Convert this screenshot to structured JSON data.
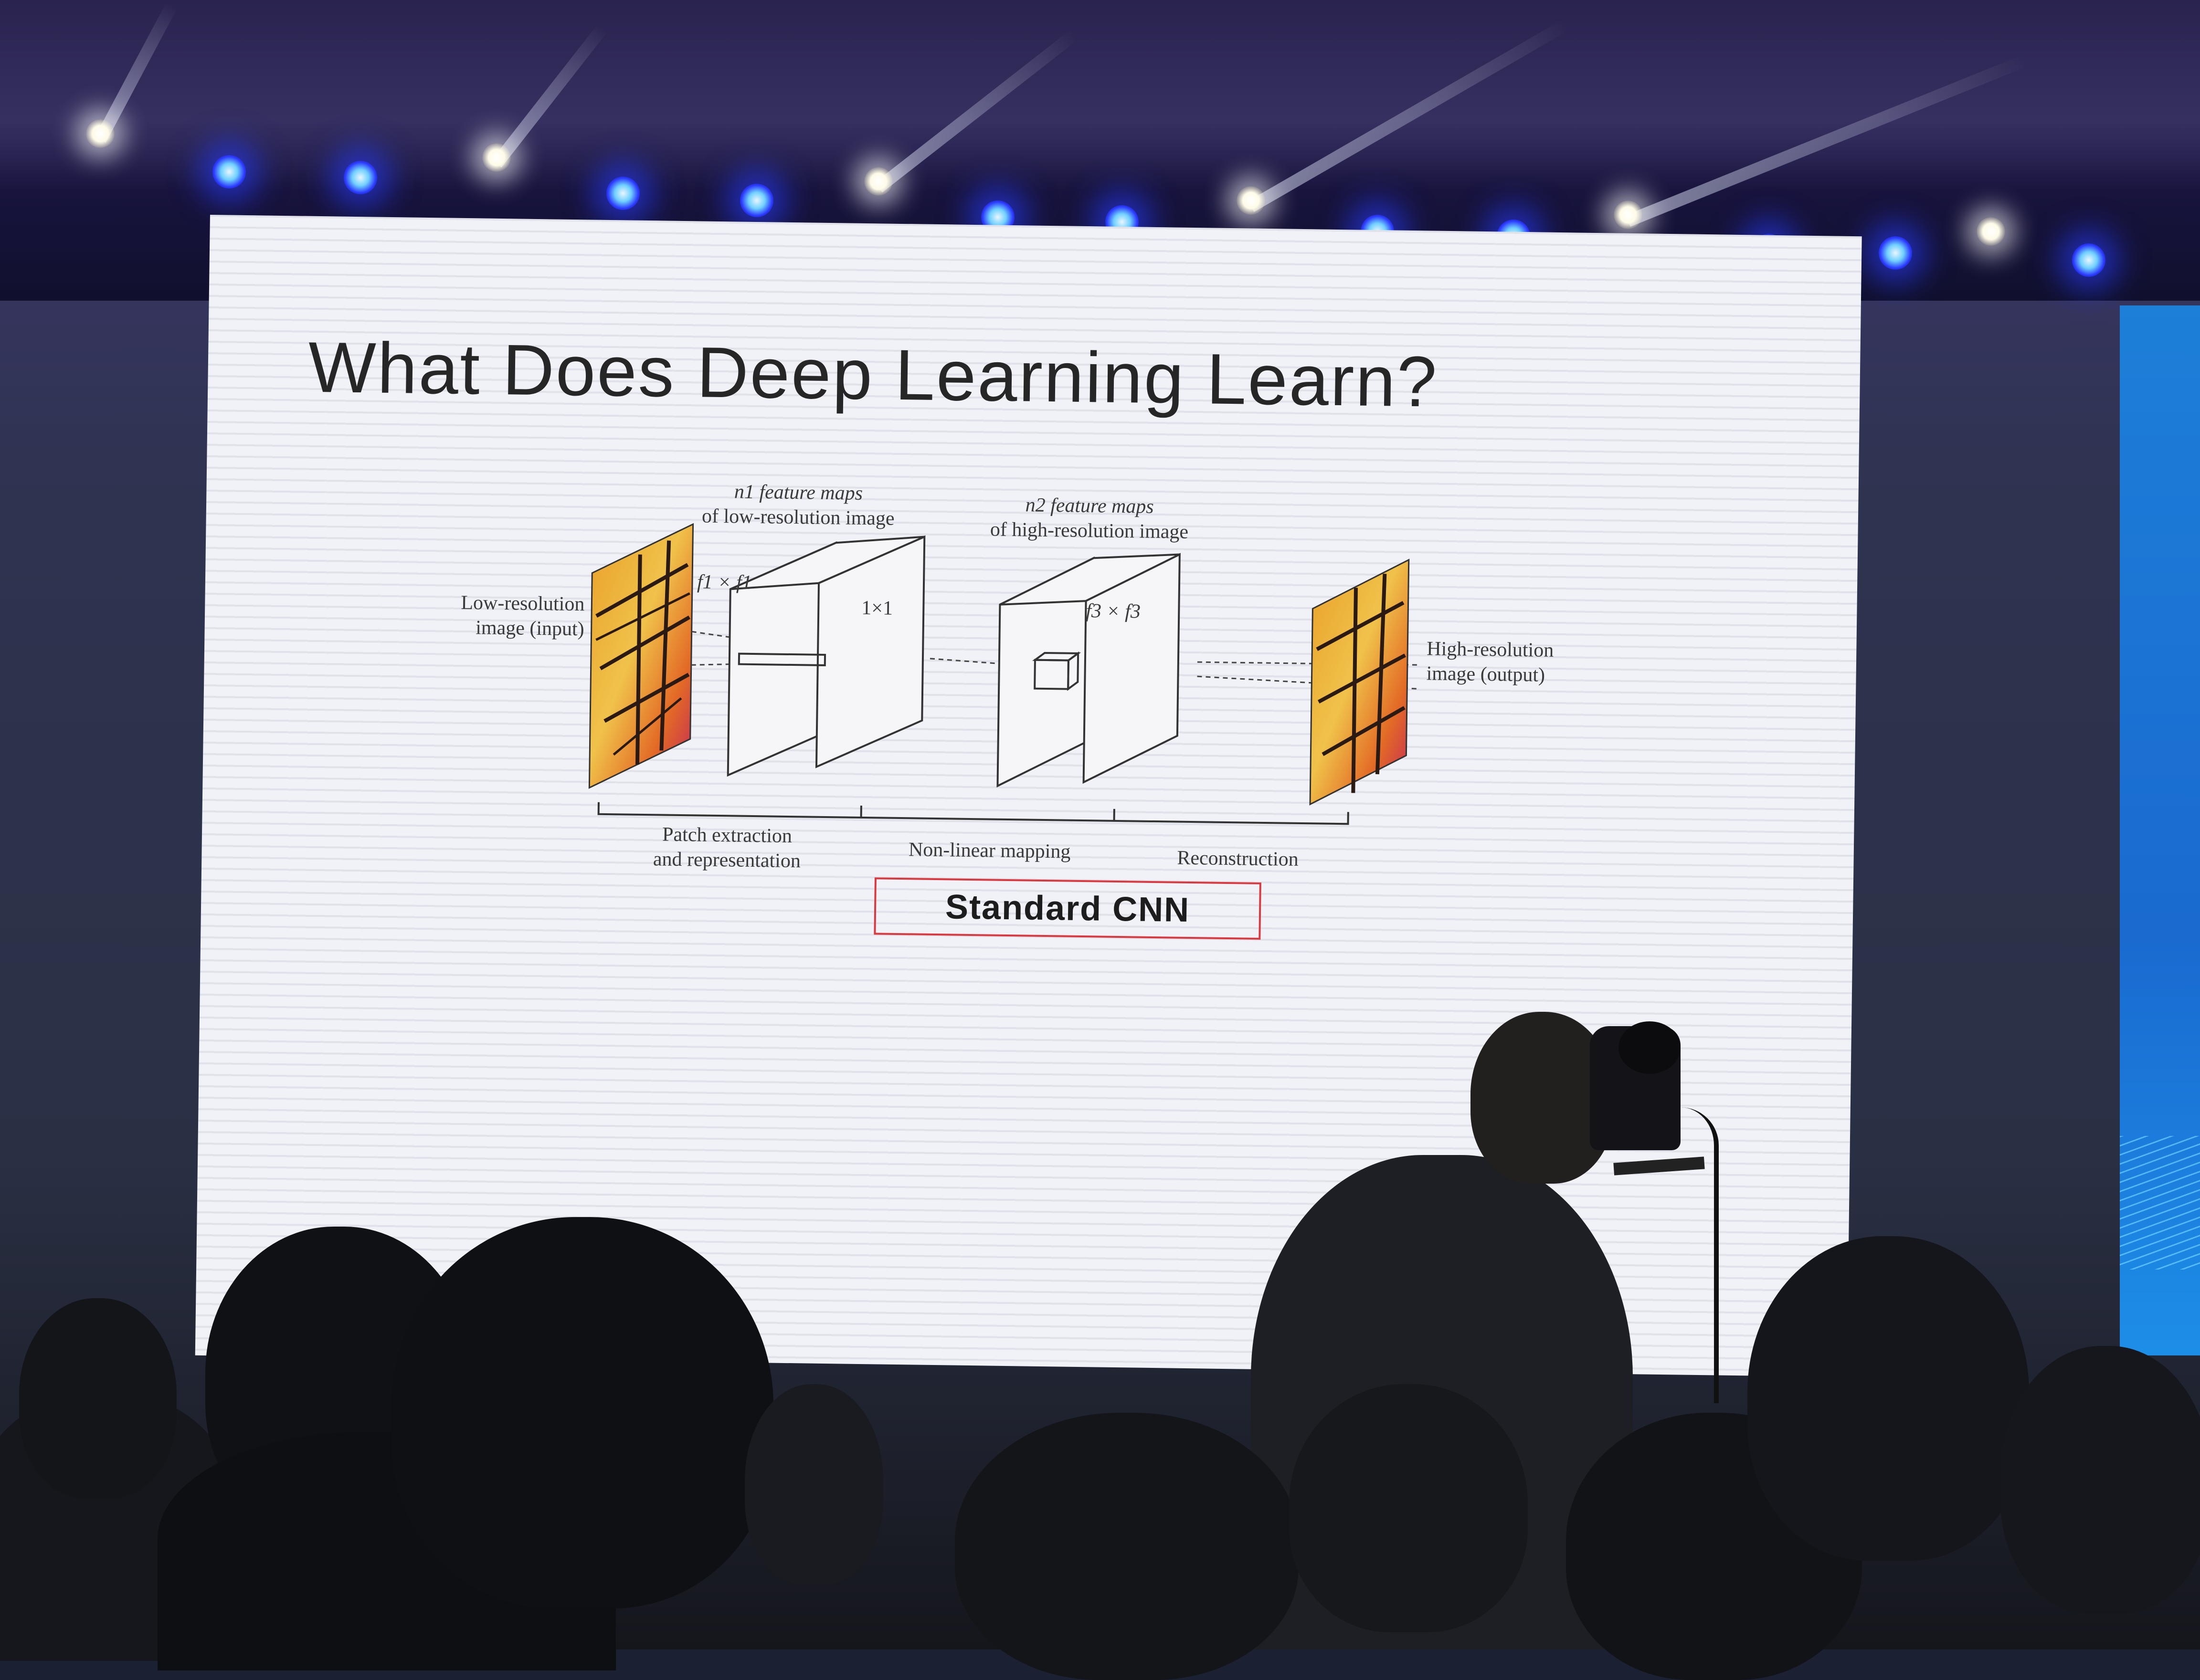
{
  "slide": {
    "title": "What Does Deep Learning Learn?",
    "box_label": "Standard CNN"
  },
  "diagram": {
    "input_label": [
      "Low-resolution",
      "image (input)"
    ],
    "output_label": [
      "High-resolution",
      "image (output)"
    ],
    "feature_maps_1": [
      "n1 feature maps",
      "of low-resolution image"
    ],
    "feature_maps_2": [
      "n2 feature maps",
      "of high-resolution image"
    ],
    "filter_1": "f1 × f1",
    "filter_2": "1×1",
    "filter_3": "f3 × f3",
    "stages": [
      "Patch extraction",
      "and representation",
      "Non-linear mapping",
      "Reconstruction"
    ]
  },
  "colors": {
    "screen_bg": "#f1f2f7",
    "title_text": "#262626",
    "box_border": "#d9393f",
    "stage_light_blue": "#2a38ff",
    "side_screen": "#1d7fd8"
  }
}
